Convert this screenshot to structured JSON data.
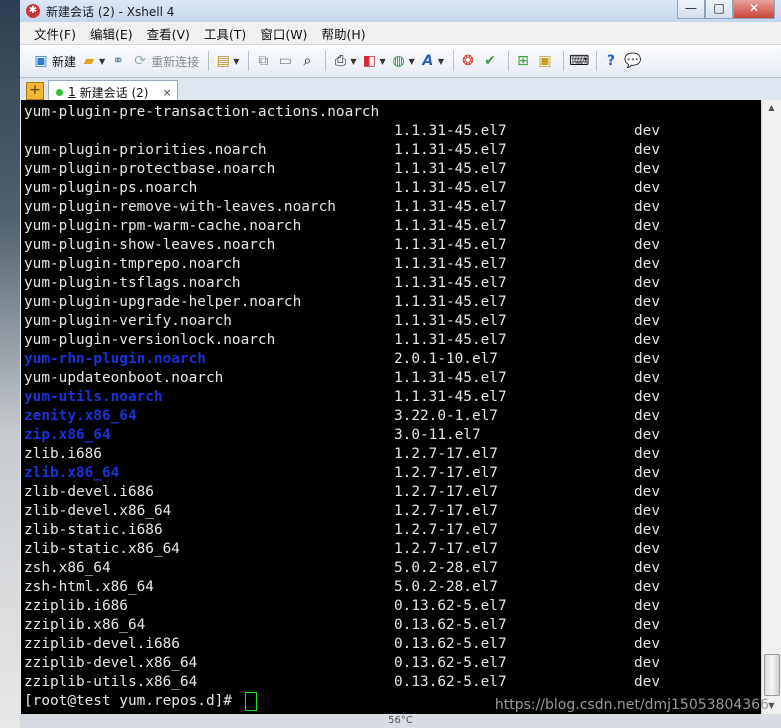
{
  "window": {
    "title": "新建会话 (2) - Xshell 4",
    "controls": {
      "minimize": "—",
      "maximize": "□",
      "close": "✕"
    }
  },
  "menu": [
    "文件(F)",
    "编辑(E)",
    "查看(V)",
    "工具(T)",
    "窗口(W)",
    "帮助(H)"
  ],
  "toolbar": {
    "new_label": "新建",
    "reconnect_label": "重新连接"
  },
  "tabs": [
    {
      "number": "1",
      "label": "新建会话 (2)",
      "close": "×"
    }
  ],
  "terminal": {
    "rows": [
      [
        "yum-plugin-pre-transaction-actions.noarch",
        "",
        "",
        false
      ],
      [
        "",
        "1.1.31-45.el7",
        "dev",
        false
      ],
      [
        "yum-plugin-priorities.noarch",
        "1.1.31-45.el7",
        "dev",
        false
      ],
      [
        "yum-plugin-protectbase.noarch",
        "1.1.31-45.el7",
        "dev",
        false
      ],
      [
        "yum-plugin-ps.noarch",
        "1.1.31-45.el7",
        "dev",
        false
      ],
      [
        "yum-plugin-remove-with-leaves.noarch",
        "1.1.31-45.el7",
        "dev",
        false
      ],
      [
        "yum-plugin-rpm-warm-cache.noarch",
        "1.1.31-45.el7",
        "dev",
        false
      ],
      [
        "yum-plugin-show-leaves.noarch",
        "1.1.31-45.el7",
        "dev",
        false
      ],
      [
        "yum-plugin-tmprepo.noarch",
        "1.1.31-45.el7",
        "dev",
        false
      ],
      [
        "yum-plugin-tsflags.noarch",
        "1.1.31-45.el7",
        "dev",
        false
      ],
      [
        "yum-plugin-upgrade-helper.noarch",
        "1.1.31-45.el7",
        "dev",
        false
      ],
      [
        "yum-plugin-verify.noarch",
        "1.1.31-45.el7",
        "dev",
        false
      ],
      [
        "yum-plugin-versionlock.noarch",
        "1.1.31-45.el7",
        "dev",
        false
      ],
      [
        "yum-rhn-plugin.noarch",
        "2.0.1-10.el7",
        "dev",
        true
      ],
      [
        "yum-updateonboot.noarch",
        "1.1.31-45.el7",
        "dev",
        false
      ],
      [
        "yum-utils.noarch",
        "1.1.31-45.el7",
        "dev",
        true
      ],
      [
        "zenity.x86_64",
        "3.22.0-1.el7",
        "dev",
        true
      ],
      [
        "zip.x86_64",
        "3.0-11.el7",
        "dev",
        true
      ],
      [
        "zlib.i686",
        "1.2.7-17.el7",
        "dev",
        false
      ],
      [
        "zlib.x86_64",
        "1.2.7-17.el7",
        "dev",
        true
      ],
      [
        "zlib-devel.i686",
        "1.2.7-17.el7",
        "dev",
        false
      ],
      [
        "zlib-devel.x86_64",
        "1.2.7-17.el7",
        "dev",
        false
      ],
      [
        "zlib-static.i686",
        "1.2.7-17.el7",
        "dev",
        false
      ],
      [
        "zlib-static.x86_64",
        "1.2.7-17.el7",
        "dev",
        false
      ],
      [
        "zsh.x86_64",
        "5.0.2-28.el7",
        "dev",
        false
      ],
      [
        "zsh-html.x86_64",
        "5.0.2-28.el7",
        "dev",
        false
      ],
      [
        "zziplib.i686",
        "0.13.62-5.el7",
        "dev",
        false
      ],
      [
        "zziplib.x86_64",
        "0.13.62-5.el7",
        "dev",
        false
      ],
      [
        "zziplib-devel.i686",
        "0.13.62-5.el7",
        "dev",
        false
      ],
      [
        "zziplib-devel.x86_64",
        "0.13.62-5.el7",
        "dev",
        false
      ],
      [
        "zziplib-utils.x86_64",
        "0.13.62-5.el7",
        "dev",
        false
      ]
    ],
    "prompt": "[root@test yum.repos.d]# "
  },
  "statusbar": {
    "temperature": "56°C"
  },
  "watermark": "https://blog.csdn.net/dmj15053804366",
  "colors": {
    "terminal_bg": "#000000",
    "terminal_fg": "#e6e6e6",
    "highlight": "#1a33d8",
    "cursor": "#21e021"
  }
}
